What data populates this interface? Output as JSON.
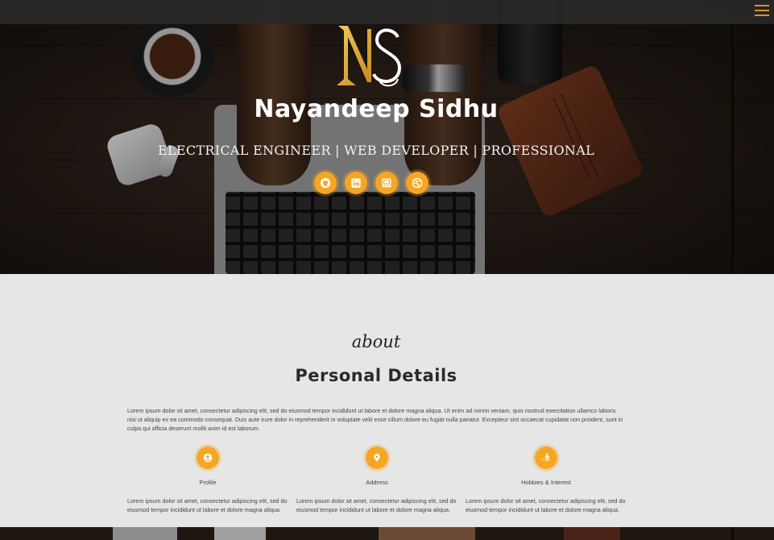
{
  "hero": {
    "name": "Nayandeep Sidhu",
    "tagline": "ELECTRICAL ENGINEER | WEB DEVELOPER | PROFESSIONAL",
    "logo_letters": "NS",
    "socials": [
      {
        "name": "github",
        "icon": "github-icon"
      },
      {
        "name": "linkedin",
        "icon": "linkedin-icon"
      },
      {
        "name": "portfolio",
        "icon": "laptop-icon"
      },
      {
        "name": "dribbble",
        "icon": "dribbble-icon"
      }
    ]
  },
  "nav": {
    "menu_icon": "hamburger-menu-icon"
  },
  "about": {
    "script_label": "about",
    "title": "Personal Details",
    "intro": "Lorem ipsum dolor sit amet, consectetur adipiscing elit, sed do eiusmod tempor incididunt ut labore et dolore magna aliqua. Ut enim ad minim veniam, quis nostrud exercitation ullamco laboris nisi ut aliquip ex ea commodo consequat. Duis aute irure dolor in reprehenderit in voluptate velit esse cillum dolore eu fugiat nulla pariatur. Excepteur sint occaecat cupidatat non proident, sunt in culpa qui officia deserunt mollit anim id est laborum",
    "cards": [
      {
        "title": "Profile",
        "icon": "user-icon",
        "text": "Lorem ipsum dolor sit amet, consectetur adipiscing elit, sed do eiusmod tempor incididunt ut labore et dolore magna aliqua."
      },
      {
        "title": "Address",
        "icon": "map-pin-icon",
        "text": "Lorem ipsum dolor sit amet, consectetur adipiscing elit, sed do eiusmod tempor incididunt ut labore et dolore magna aliqua."
      },
      {
        "title": "Hobbies & Interest",
        "icon": "running-icon",
        "text": "Lorem ipsum dolor sit amet, consectetur adipiscing elit, sed do eiusmod tempor incididunt ut labore et dolore magna aliqua."
      }
    ]
  },
  "colors": {
    "accent": "#f5a623",
    "menu": "#d9932c",
    "text_dark": "#2a2a2a",
    "section_bg": "#e6e6e6"
  }
}
